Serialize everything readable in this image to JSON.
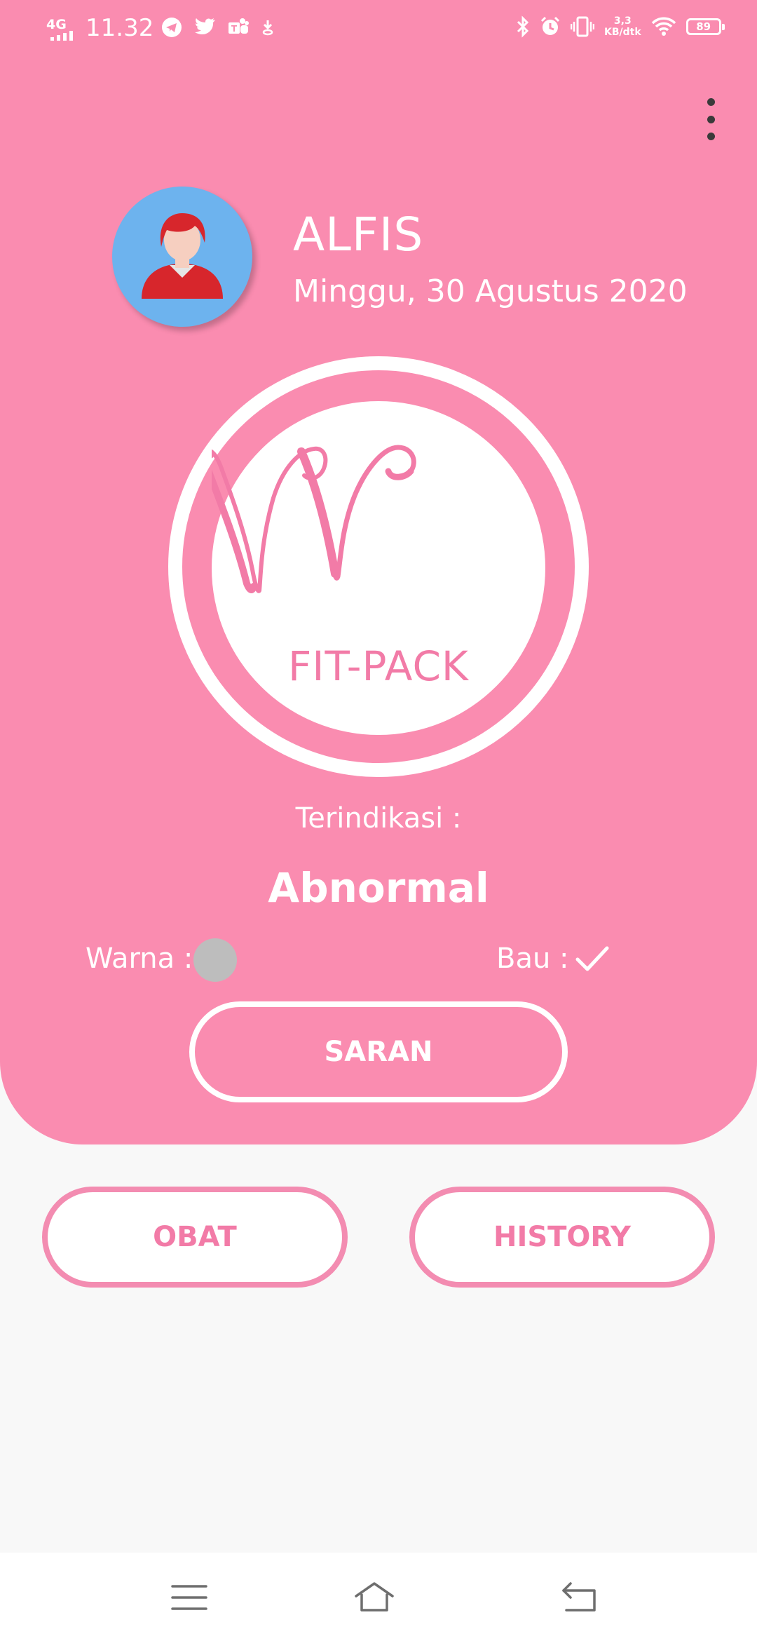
{
  "status_bar": {
    "network": "4G",
    "time": "11.32",
    "speed_value": "3,3",
    "speed_unit": "KB/dtk",
    "battery": "89",
    "icons_left": [
      "telegram-icon",
      "twitter-icon",
      "teams-icon",
      "download-icon"
    ],
    "icons_right": [
      "bluetooth-icon",
      "alarm-icon",
      "vibrate-icon",
      "wifi-icon",
      "battery-icon"
    ]
  },
  "colors": {
    "primary": "#fa8cb0",
    "accent_text": "#f27ba7",
    "background": "#f8f8f8",
    "swatch": "#bdbdbd",
    "avatar_bg": "#6db3ee"
  },
  "user": {
    "name": "ALFIS",
    "date": "Minggu, 30 Agustus 2020"
  },
  "logo": {
    "text": "FIT-PACK"
  },
  "result": {
    "label": "Terindikasi :",
    "value": "Abnormal"
  },
  "details": {
    "color_label": "Warna :",
    "smell_label": "Bau :"
  },
  "buttons": {
    "saran": "SARAN",
    "obat": "OBAT",
    "history": "HISTORY"
  }
}
